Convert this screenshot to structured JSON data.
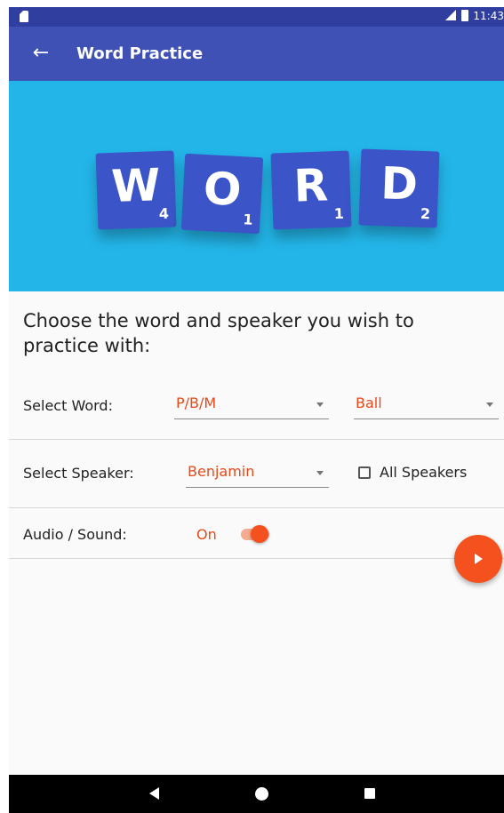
{
  "status_bar": {
    "time": "11:43"
  },
  "app_bar": {
    "title": "Word Practice",
    "back_icon": "arrow-back-icon"
  },
  "banner": {
    "tiles": [
      {
        "letter": "W",
        "score": "4"
      },
      {
        "letter": "O",
        "score": "1"
      },
      {
        "letter": "R",
        "score": "1"
      },
      {
        "letter": "D",
        "score": "2"
      }
    ],
    "colors": {
      "background": "#23b5e8",
      "tile": "#3b55c9"
    }
  },
  "prompt": "Choose the word and speaker you wish to practice with:",
  "select_word": {
    "label": "Select Word:",
    "group_value": "P/B/M",
    "word_value": "Ball"
  },
  "select_speaker": {
    "label": "Select Speaker:",
    "value": "Benjamin",
    "all_speakers_label": "All Speakers",
    "all_speakers_checked": false
  },
  "audio": {
    "label": "Audio / Sound:",
    "state_label": "On",
    "enabled": true
  },
  "fab": {
    "icon": "play-icon"
  },
  "nav": {
    "back_icon": "nav-back-icon",
    "home_icon": "nav-home-icon",
    "recents_icon": "nav-recents-icon"
  },
  "colors": {
    "primary": "#3f51b5",
    "primary_dark": "#303f9f",
    "accent": "#f4511e"
  }
}
